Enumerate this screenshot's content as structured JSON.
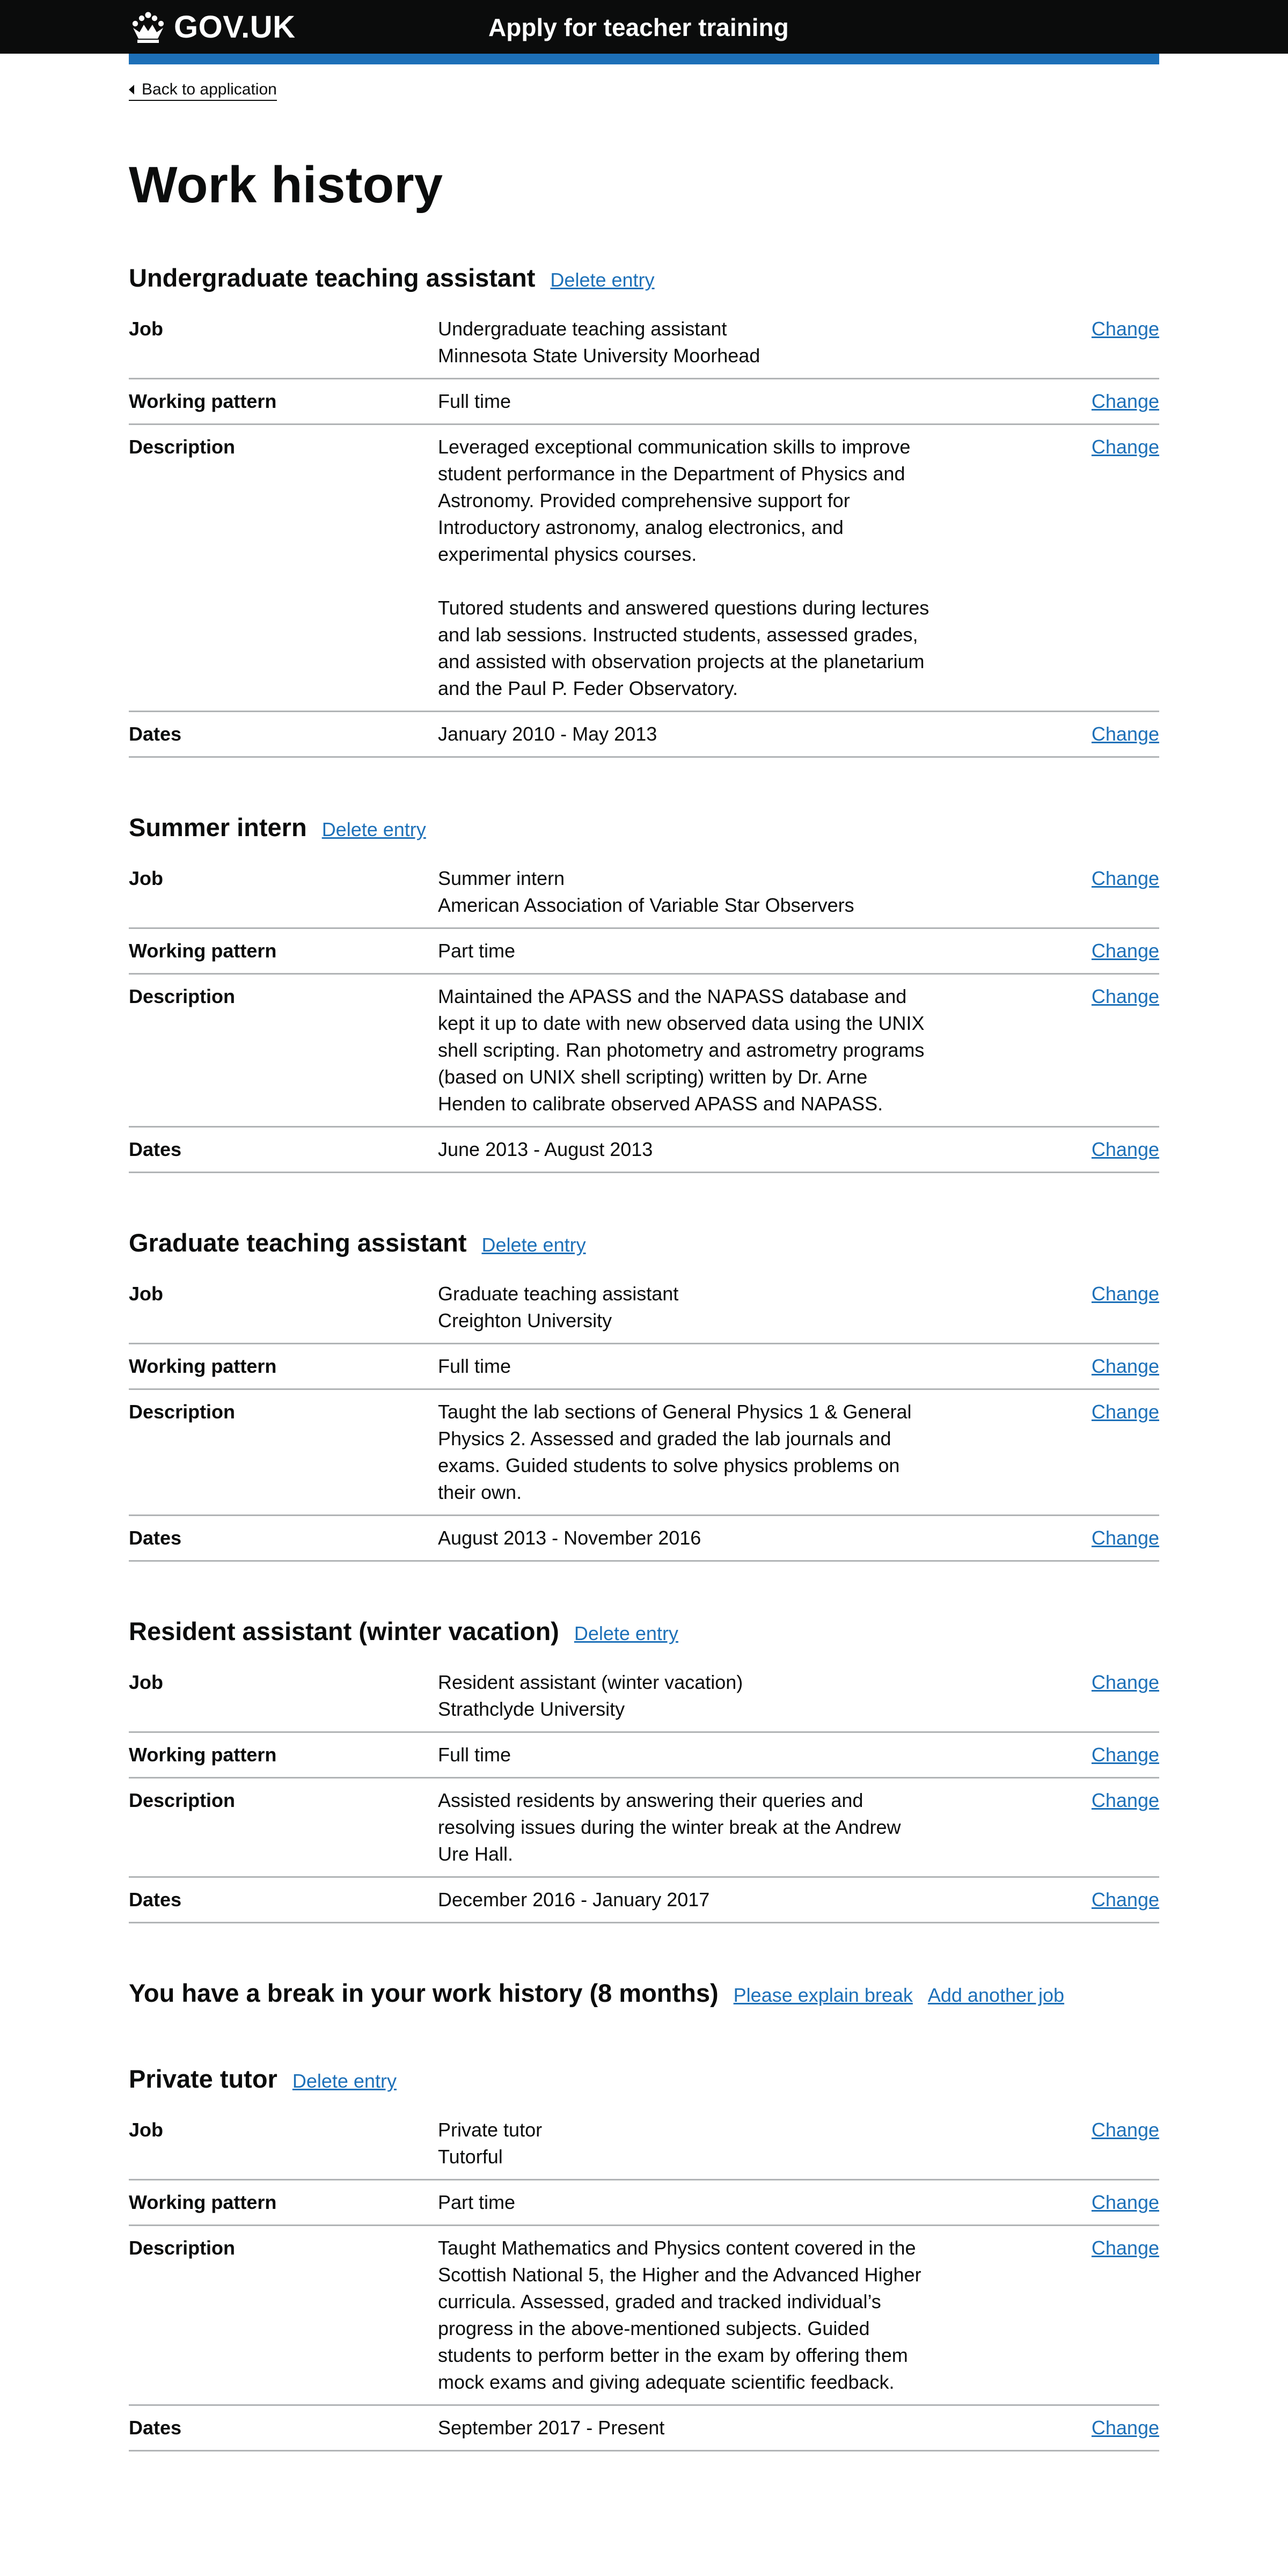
{
  "header": {
    "logo_text": "GOV.UK",
    "service_name": "Apply for teacher training"
  },
  "back_link": "Back to application",
  "page_title": "Work history",
  "labels": {
    "job": "Job",
    "working_pattern": "Working pattern",
    "description": "Description",
    "dates": "Dates",
    "change": "Change",
    "delete": "Delete entry"
  },
  "jobs": [
    {
      "title": "Undergraduate teaching assistant",
      "job": "Undergraduate teaching assistant\nMinnesota State University Moorhead",
      "working_pattern": "Full time",
      "description": "Leveraged exceptional communication skills to improve student performance in the Department of Physics and Astronomy. Provided comprehensive support for Introductory astronomy, analog electronics, and experimental physics courses.\n\nTutored students and answered questions during lectures and lab sessions. Instructed students, assessed grades, and assisted with observation projects at the planetarium and the Paul P. Feder Observatory.",
      "dates": "January 2010 - May 2013"
    },
    {
      "title": "Summer intern",
      "job": "Summer intern\nAmerican Association of Variable Star Observers",
      "working_pattern": "Part time",
      "description": "Maintained the APASS and the NAPASS database and kept it up to date with new observed data using the UNIX shell scripting. Ran photometry and astrometry programs (based on UNIX shell scripting) written by Dr. Arne Henden to calibrate observed APASS and NAPASS.",
      "dates": "June 2013 - August 2013"
    },
    {
      "title": "Graduate teaching assistant",
      "job": "Graduate teaching assistant\nCreighton University",
      "working_pattern": "Full time",
      "description": "Taught the lab sections of General Physics 1 & General Physics 2. Assessed and graded the lab journals and exams. Guided students to solve physics problems on their own.",
      "dates": "August 2013 - November 2016"
    },
    {
      "title": "Resident assistant (winter vacation)",
      "job": "Resident assistant (winter vacation)\nStrathclyde University",
      "working_pattern": "Full time",
      "description": "Assisted residents by answering their queries and resolving issues during the winter break at the Andrew Ure Hall.",
      "dates": "December 2016 - January 2017"
    }
  ],
  "break": {
    "heading": "You have a break in your work history (8 months)",
    "explain_link": "Please explain break",
    "add_link": "Add another job"
  },
  "jobs_after": [
    {
      "title": "Private tutor",
      "job": "Private tutor\nTutorful",
      "working_pattern": "Part time",
      "description": "Taught Mathematics and Physics content covered in the Scottish National 5, the Higher and the Advanced Higher curricula. Assessed, graded and tracked individual’s progress in the above-mentioned subjects. Guided students to perform better in the exam by offering them mock exams and giving adequate scientific feedback.",
      "dates": "September 2017 - Present"
    }
  ]
}
